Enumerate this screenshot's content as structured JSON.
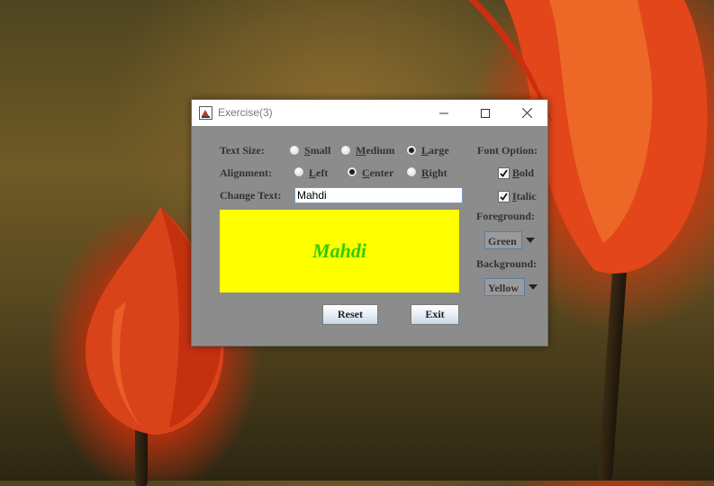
{
  "window": {
    "title": "Exercise(3)",
    "icon": "java-app-icon",
    "controls": [
      "minimize-icon",
      "maximize-icon",
      "close-icon"
    ]
  },
  "text_size": {
    "label": "Text Size:",
    "options": [
      {
        "label": "Small",
        "selected": false
      },
      {
        "label": "Medium",
        "selected": false
      },
      {
        "label": "Large",
        "selected": true
      }
    ]
  },
  "alignment": {
    "label": "Alignment:",
    "options": [
      {
        "label": "Left",
        "selected": false
      },
      {
        "label": "Center",
        "selected": true
      },
      {
        "label": "Right",
        "selected": false
      }
    ]
  },
  "change_text": {
    "label": "Change Text:",
    "value": "Mahdi"
  },
  "preview": {
    "text": "Mahdi",
    "foreground": "#33cc00",
    "background": "#ffff00"
  },
  "font_option": {
    "label": "Font Option:",
    "bold": {
      "label": "Bold",
      "checked": true
    },
    "italic": {
      "label": "Italic",
      "checked": true
    }
  },
  "foreground": {
    "label": "Foreground:",
    "selected": "Green"
  },
  "background": {
    "label": "Background:",
    "selected": "Yellow"
  },
  "buttons": {
    "reset": "Reset",
    "exit": "Exit"
  },
  "colors": {
    "panel": "#8c8c8c",
    "titlebar": "#ffffff"
  }
}
